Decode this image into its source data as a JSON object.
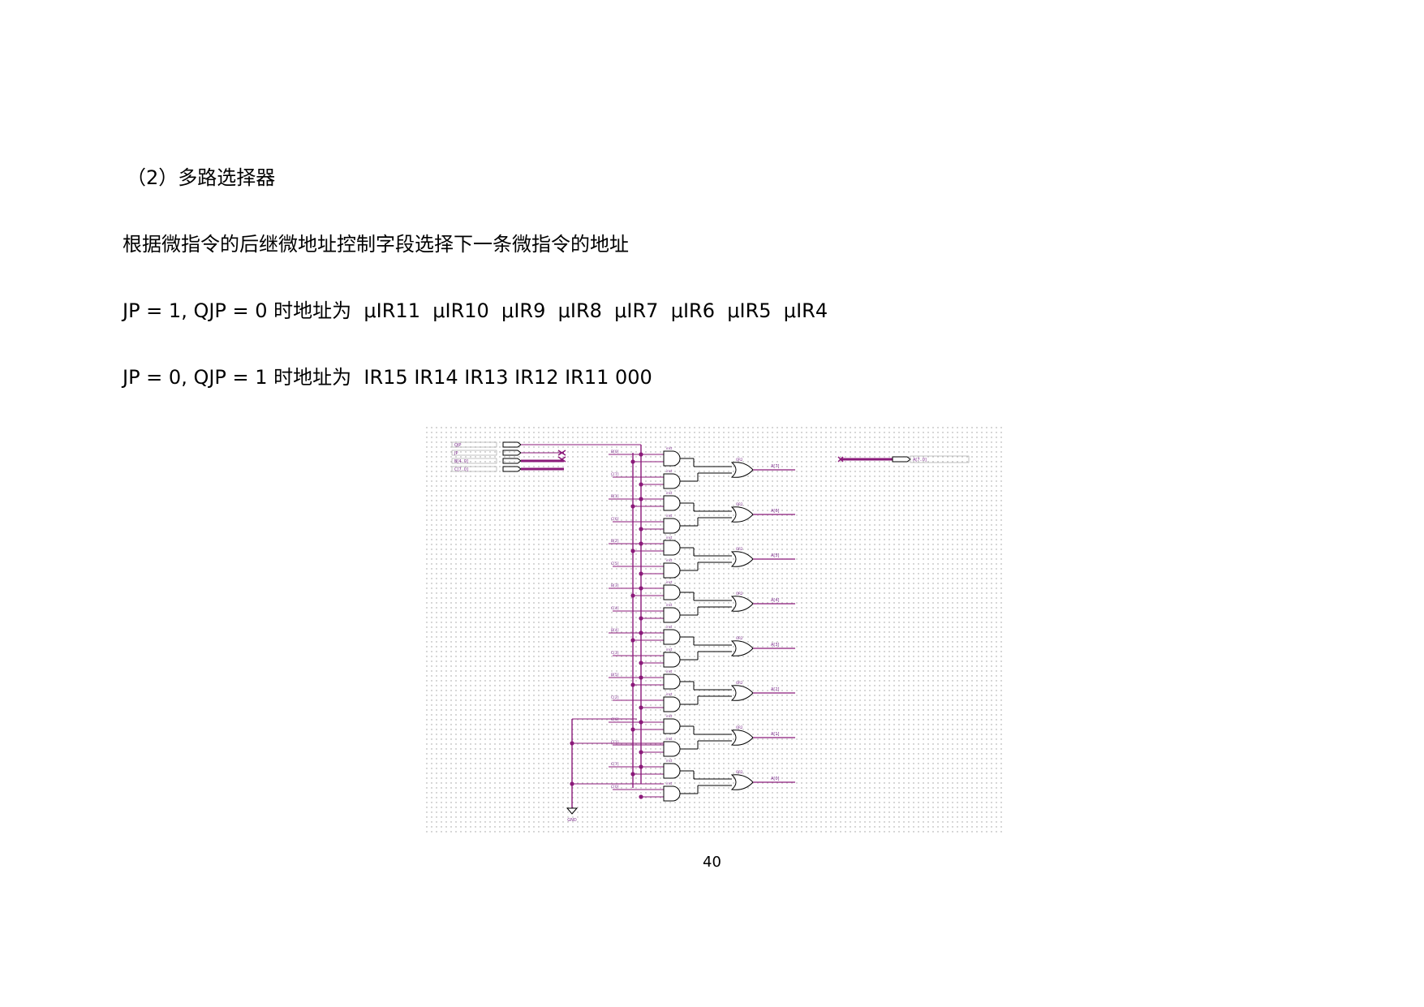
{
  "section_heading": "（2）多路选择器",
  "paragraph": "根据微指令的后继微地址控制字段选择下一条微指令的地址",
  "rule_jp1": "JP = 1, QJP = 0 时地址为  μIR11  μIR10  μIR9  μIR8  μIR7  μIR6  μIR5  μIR4",
  "rule_jp0": "JP = 0, QJP = 1 时地址为  IR15 IR14 IR13 IR12 IR11 000",
  "page_number": "40",
  "schematic": {
    "input_ports": [
      "QJP",
      "JP",
      "B[4..0]",
      "C[7..0]"
    ],
    "output_bus": "A[7..0]",
    "outputs": [
      "A[7]",
      "A[6]",
      "A[5]",
      "A[4]",
      "A[3]",
      "A[2]",
      "A[1]",
      "A[0]"
    ],
    "and_gate_count": 16,
    "or_gate_count": 8,
    "ground_label": "GND",
    "colors": {
      "wire": "#8b1a7a",
      "gate": "#000000",
      "grid": "#9a9a9a",
      "label": "#7a2a8a"
    }
  }
}
